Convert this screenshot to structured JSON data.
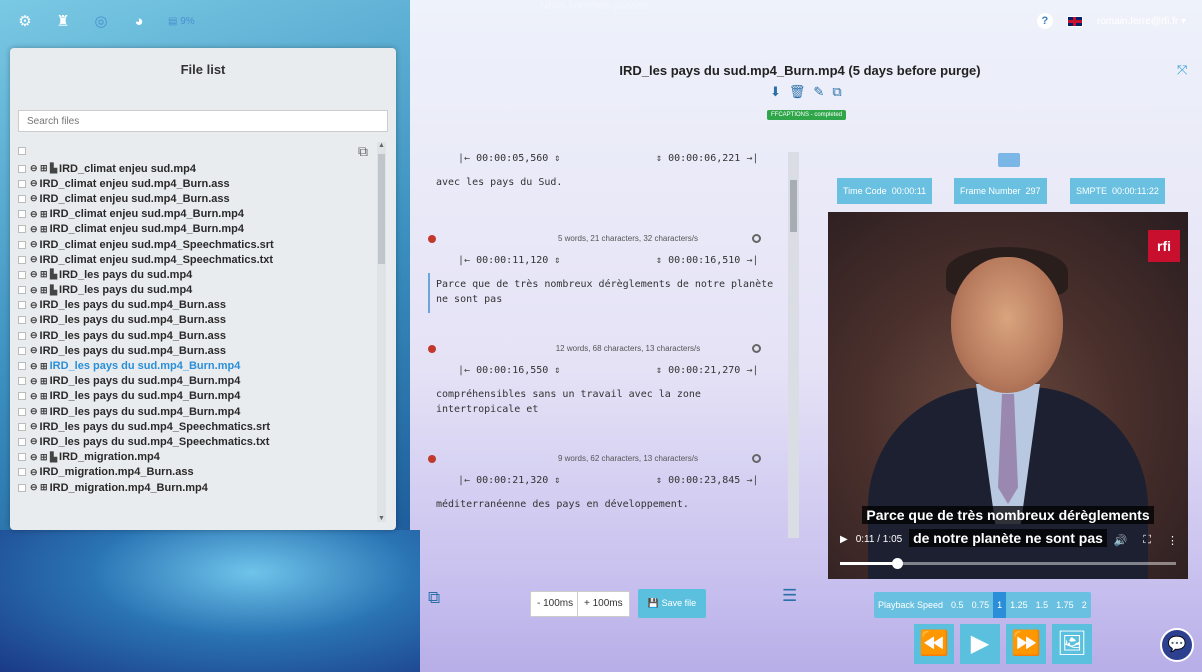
{
  "topbar": {
    "icons": [
      "settings-icon",
      "binoculars-icon",
      "network-icon",
      "dashboard-icon",
      "storage-icon"
    ],
    "storage_text": "9%",
    "ghost_text": "Nous sommes passés",
    "user_email": "romain.ferre@rfi.fr",
    "user_caret": "▾"
  },
  "file_panel": {
    "title": "File list",
    "search_placeholder": "Search files",
    "files": [
      {
        "icons": "⊖ ⊞ ▙",
        "name": "IRD_climat enjeu sud.mp4",
        "active": false
      },
      {
        "icons": "⊖",
        "name": "IRD_climat enjeu sud.mp4_Burn.ass",
        "active": false
      },
      {
        "icons": "⊖",
        "name": "IRD_climat enjeu sud.mp4_Burn.ass",
        "active": false
      },
      {
        "icons": "⊖ ⊞",
        "name": "IRD_climat enjeu sud.mp4_Burn.mp4",
        "active": false
      },
      {
        "icons": "⊖ ⊞",
        "name": "IRD_climat enjeu sud.mp4_Burn.mp4",
        "active": false
      },
      {
        "icons": "⊖",
        "name": "IRD_climat enjeu sud.mp4_Speechmatics.srt",
        "active": false
      },
      {
        "icons": "⊖",
        "name": "IRD_climat enjeu sud.mp4_Speechmatics.txt",
        "active": false
      },
      {
        "icons": "⊖ ⊞ ▙",
        "name": "IRD_les pays du sud.mp4",
        "active": false
      },
      {
        "icons": "⊖ ⊞ ▙",
        "name": "IRD_les pays du sud.mp4",
        "active": false
      },
      {
        "icons": "⊖",
        "name": "IRD_les pays du sud.mp4_Burn.ass",
        "active": false
      },
      {
        "icons": "⊖",
        "name": "IRD_les pays du sud.mp4_Burn.ass",
        "active": false
      },
      {
        "icons": "⊖",
        "name": "IRD_les pays du sud.mp4_Burn.ass",
        "active": false
      },
      {
        "icons": "⊖",
        "name": "IRD_les pays du sud.mp4_Burn.ass",
        "active": false
      },
      {
        "icons": "⊖ ⊞",
        "name": "IRD_les pays du sud.mp4_Burn.mp4",
        "active": true
      },
      {
        "icons": "⊖ ⊞",
        "name": "IRD_les pays du sud.mp4_Burn.mp4",
        "active": false
      },
      {
        "icons": "⊖ ⊞",
        "name": "IRD_les pays du sud.mp4_Burn.mp4",
        "active": false
      },
      {
        "icons": "⊖ ⊞",
        "name": "IRD_les pays du sud.mp4_Burn.mp4",
        "active": false
      },
      {
        "icons": "⊖",
        "name": "IRD_les pays du sud.mp4_Speechmatics.srt",
        "active": false
      },
      {
        "icons": "⊖",
        "name": "IRD_les pays du sud.mp4_Speechmatics.txt",
        "active": false
      },
      {
        "icons": "⊖ ⊞ ▙",
        "name": "IRD_migration.mp4",
        "active": false
      },
      {
        "icons": "⊖",
        "name": "IRD_migration.mp4_Burn.ass",
        "active": false
      },
      {
        "icons": "⊖ ⊞",
        "name": "IRD_migration.mp4_Burn.mp4",
        "active": false
      }
    ]
  },
  "main": {
    "title": "IRD_les pays du sud.mp4_Burn.mp4 (5 days before purge)",
    "status_badge": "FFCAPTIONS - completed",
    "actions": [
      "download-icon",
      "trash-icon",
      "pencil-icon",
      "copy-icon"
    ]
  },
  "editor": {
    "subtitles": [
      {
        "start": "00:00:05,560",
        "end": "00:00:06,221",
        "text": "avec les pays du Sud.",
        "stats": ""
      },
      {
        "start": "00:00:11,120",
        "end": "00:00:16,510",
        "text": "Parce que de très nombreux dérèglements de notre planète ne sont pas",
        "stats": "5 words, 21 characters, 32 characters/s"
      },
      {
        "start": "00:00:16,550",
        "end": "00:00:21,270",
        "text": "compréhensibles sans un travail avec la zone intertropicale et",
        "stats": "12 words, 68 characters, 13 characters/s"
      },
      {
        "start": "00:00:21,320",
        "end": "00:00:23,845",
        "text": "méditerranéenne des pays en développement.",
        "stats": "9 words, 62 characters, 13 characters/s"
      }
    ],
    "buttons": {
      "minus": "- 100ms",
      "plus": "+ 100ms",
      "save": "Save file"
    }
  },
  "video": {
    "timecode_label": "Time Code",
    "timecode_value": "00:00:11",
    "frame_label": "Frame Number",
    "frame_value": "297",
    "smpte_label": "SMPTE",
    "smpte_value": "00:00:11:22",
    "caption_line1": "Parce que de très nombreux dérèglements",
    "caption_line2": "de notre planète ne sont pas",
    "time_display": "0:11 / 1:05",
    "progress": 0.17,
    "logo": "rfi"
  },
  "playback": {
    "label": "Playback Speed",
    "speeds": [
      "0.5",
      "0.75",
      "1",
      "1.25",
      "1.5",
      "1.75",
      "2"
    ],
    "active_speed": "1"
  }
}
